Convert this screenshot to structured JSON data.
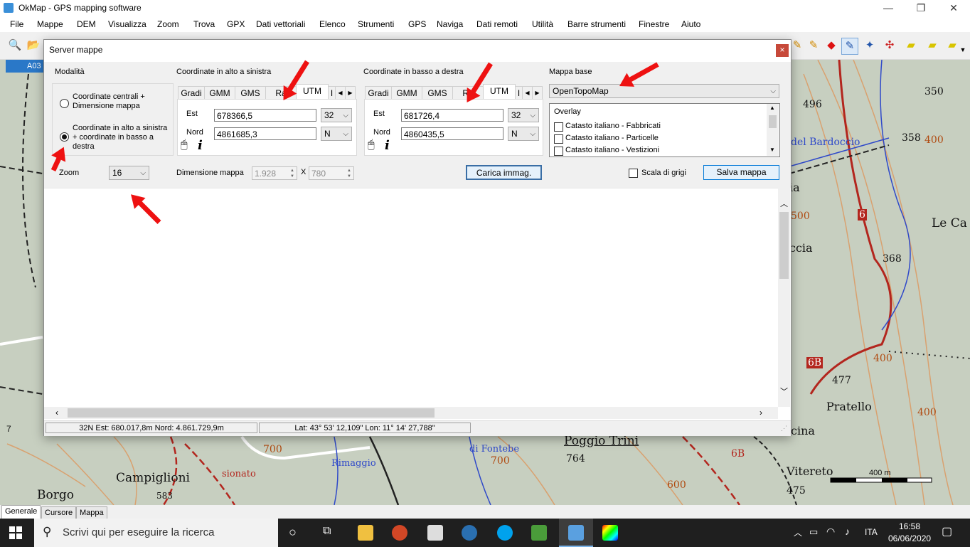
{
  "window": {
    "title": "OkMap - GPS mapping software"
  },
  "menu": [
    "File",
    "Mappe",
    "DEM",
    "Visualizza",
    "Zoom",
    "Trova",
    "GPX",
    "Dati vettoriali",
    "Elenco",
    "Strumenti",
    "GPS",
    "Naviga",
    "Dati remoti",
    "Utilità",
    "Barre strumenti",
    "Finestre",
    "Aiuto"
  ],
  "map": {
    "tab_label": "A03",
    "labels": {
      "n496": "496",
      "n350": "350",
      "n358": "358",
      "n400a": "400",
      "n400b": "400",
      "n400c": "400",
      "n368": "368",
      "n477": "477",
      "n764": "764",
      "n583": "583",
      "n475": "475",
      "n700a": "700",
      "n700b": "700",
      "n600": "600",
      "n500": "500",
      "bardoccio": "del Bardoccio",
      "lecas": "Le Ca",
      "ccia": "ccia",
      "ia": "ia",
      "pratello": "Pratello",
      "cina": "cina",
      "poggio": "Poggio Trini",
      "campiglioni": "Campiglioni",
      "borgo": "Borgo",
      "vitereto": "Vitereto",
      "b6": "6B",
      "b6b": "6B",
      "r6": "6",
      "rimaggio": "Rimaggio",
      "fontebe": "di Fontebe",
      "sionato": "sionato",
      "scale": "400 m",
      "seven": "7"
    }
  },
  "bottom_tabs": [
    "Generale",
    "Cursore",
    "Mappa"
  ],
  "taskbar": {
    "search_placeholder": "Scrivi qui per eseguire la ricerca",
    "lang": "ITA",
    "time": "16:58",
    "date": "06/06/2020"
  },
  "dialog": {
    "title": "Server mappe",
    "close": "×",
    "mode": {
      "label": "Modalità",
      "option1": [
        "Coordinate centrali +",
        "Dimensione mappa"
      ],
      "option2": [
        "Coordinate in alto a sinistra",
        "+ coordinate in basso a",
        "destra"
      ],
      "selected": 2
    },
    "top_left": {
      "label": "Coordinate in alto a sinistra",
      "tabs": [
        "Gradi",
        "GMM",
        "GMS",
        "Ra",
        "UTM",
        "I"
      ],
      "active_tab": "UTM",
      "est_label": "Est",
      "est_value": "678366,5",
      "zone": "32",
      "nord_label": "Nord",
      "nord_value": "4861685,3",
      "hemisphere": "N"
    },
    "bottom_right": {
      "label": "Coordinate in basso a destra",
      "tabs": [
        "Gradi",
        "GMM",
        "GMS",
        "Ra",
        "UTM",
        "I"
      ],
      "active_tab": "UTM",
      "est_label": "Est",
      "est_value": "681726,4",
      "zone": "32",
      "nord_label": "Nord",
      "nord_value": "4860435,5",
      "hemisphere": "N"
    },
    "base_map": {
      "label": "Mappa base",
      "selected": "OpenTopoMap",
      "overlay_label": "Overlay",
      "overlays": [
        "Catasto italiano - Fabbricati",
        "Catasto italiano - Particelle",
        "Catasto italiano - Vestizioni"
      ]
    },
    "zoom": {
      "label": "Zoom",
      "value": "16"
    },
    "dimension": {
      "label": "Dimensione mappa",
      "width": "1.928",
      "sep": "X",
      "height": "780"
    },
    "load_button": "Carica immag.",
    "grayscale_label": "Scala di grigi",
    "save_button": "Salva mappa",
    "status": {
      "utm": "32N  Est: 680.017,8m  Nord: 4.861.729,9m",
      "latlon": "Lat: 43° 53' 12,109\"  Lon: 11° 14' 27,788\""
    },
    "arrow_left": "◀",
    "arrow_right": "▶"
  }
}
